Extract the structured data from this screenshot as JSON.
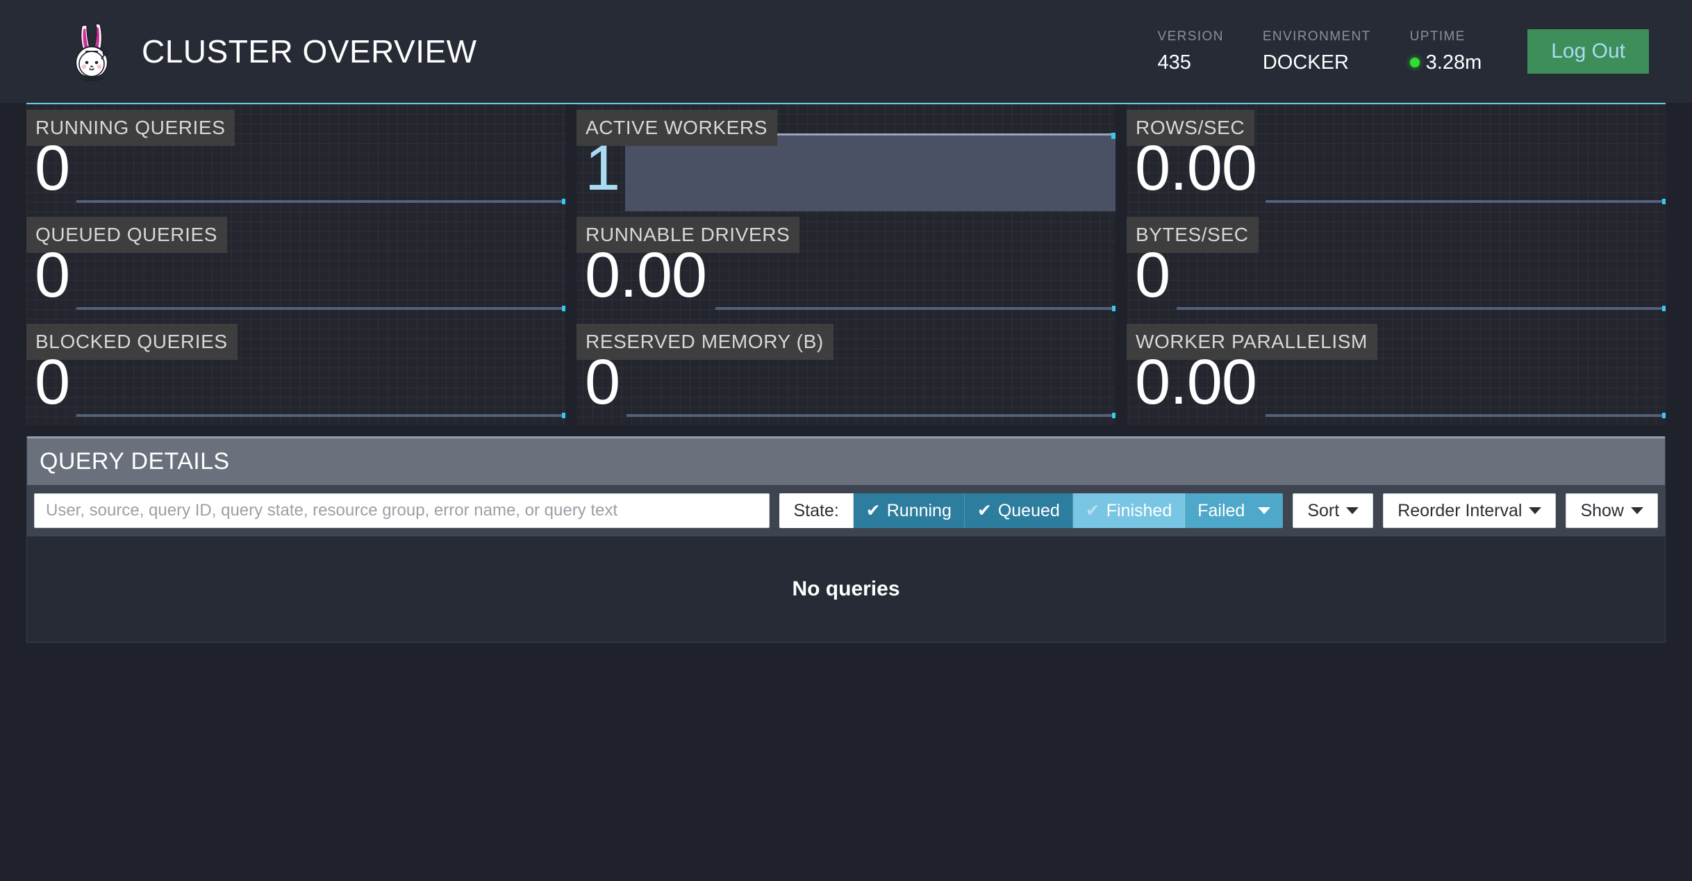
{
  "header": {
    "logo_icon": "trino-bunny-astronaut-logo",
    "title": "CLUSTER OVERVIEW",
    "stats": [
      {
        "label": "VERSION",
        "value": "435"
      },
      {
        "label": "ENVIRONMENT",
        "value": "DOCKER"
      },
      {
        "label": "UPTIME",
        "value": "3.28m",
        "has_status_dot": true
      }
    ],
    "logout_label": "Log Out",
    "accent_color": "#66ccdd",
    "logout_bg": "#3e8e5a",
    "logout_text_color": "#a9dcf2",
    "status_dot_color": "#2ee02e"
  },
  "tiles": [
    {
      "label": "RUNNING QUERIES",
      "value": "0",
      "spark": "line"
    },
    {
      "label": "ACTIVE WORKERS",
      "value": "1",
      "spark": "area",
      "accent": true
    },
    {
      "label": "ROWS/SEC",
      "value": "0.00",
      "spark": "line"
    },
    {
      "label": "QUEUED QUERIES",
      "value": "0",
      "spark": "line"
    },
    {
      "label": "RUNNABLE DRIVERS",
      "value": "0.00",
      "spark": "line"
    },
    {
      "label": "BYTES/SEC",
      "value": "0",
      "spark": "line"
    },
    {
      "label": "BLOCKED QUERIES",
      "value": "0",
      "spark": "line"
    },
    {
      "label": "RESERVED MEMORY (B)",
      "value": "0",
      "spark": "line"
    },
    {
      "label": "WORKER PARALLELISM",
      "value": "0.00",
      "spark": "line"
    }
  ],
  "query_details": {
    "title": "QUERY DETAILS",
    "search_placeholder": "User, source, query ID, query state, resource group, error name, or query text",
    "search_value": "",
    "state_label": "State:",
    "state_buttons": [
      {
        "label": "Running",
        "checked": true,
        "style": "dark",
        "caret": false
      },
      {
        "label": "Queued",
        "checked": true,
        "style": "dark",
        "caret": false
      },
      {
        "label": "Finished",
        "checked": true,
        "style": "light",
        "caret": false,
        "muted_check": true
      },
      {
        "label": "Failed",
        "checked": false,
        "style": "mid",
        "caret": true
      }
    ],
    "dropdowns": [
      {
        "label": "Sort"
      },
      {
        "label": "Reorder Interval"
      },
      {
        "label": "Show"
      }
    ],
    "empty_message": "No queries"
  }
}
